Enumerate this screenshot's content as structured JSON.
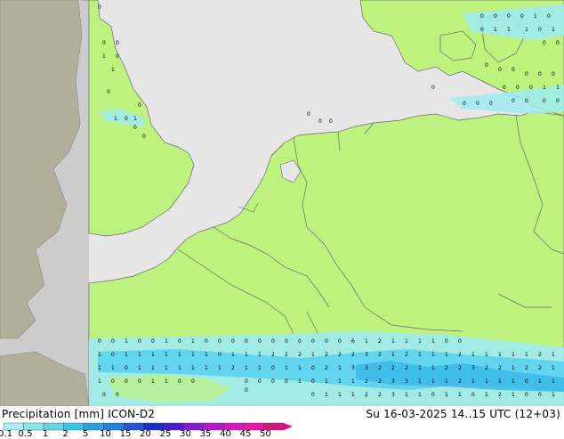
{
  "header": {
    "product": "Precipitation [mm]",
    "model": "ICON-D2",
    "valid_time": "Su 16-03-2025 14..15 UTC (12+03)"
  },
  "legend": {
    "ticks": [
      "0.1",
      "0.5",
      "1",
      "2",
      "5",
      "10",
      "15",
      "20",
      "25",
      "30",
      "35",
      "40",
      "45",
      "50"
    ],
    "colors": [
      "#a8f0f0",
      "#88e6ee",
      "#60d8ea",
      "#38c6e6",
      "#28a2e2",
      "#2480de",
      "#1e56d6",
      "#1b2dc8",
      "#4a1bd0",
      "#8a18d2",
      "#b816cf",
      "#d816c0",
      "#e416a8",
      "#d01480"
    ]
  },
  "map": {
    "land_color": "#bdf27f",
    "sea_color": "#e6e6e6",
    "outside_domain_color": "#cccccc",
    "outside_land_color": "#b0b09a",
    "precip_light_color": "#9fe9f0",
    "precip_mid_color": "#58d0ee"
  }
}
